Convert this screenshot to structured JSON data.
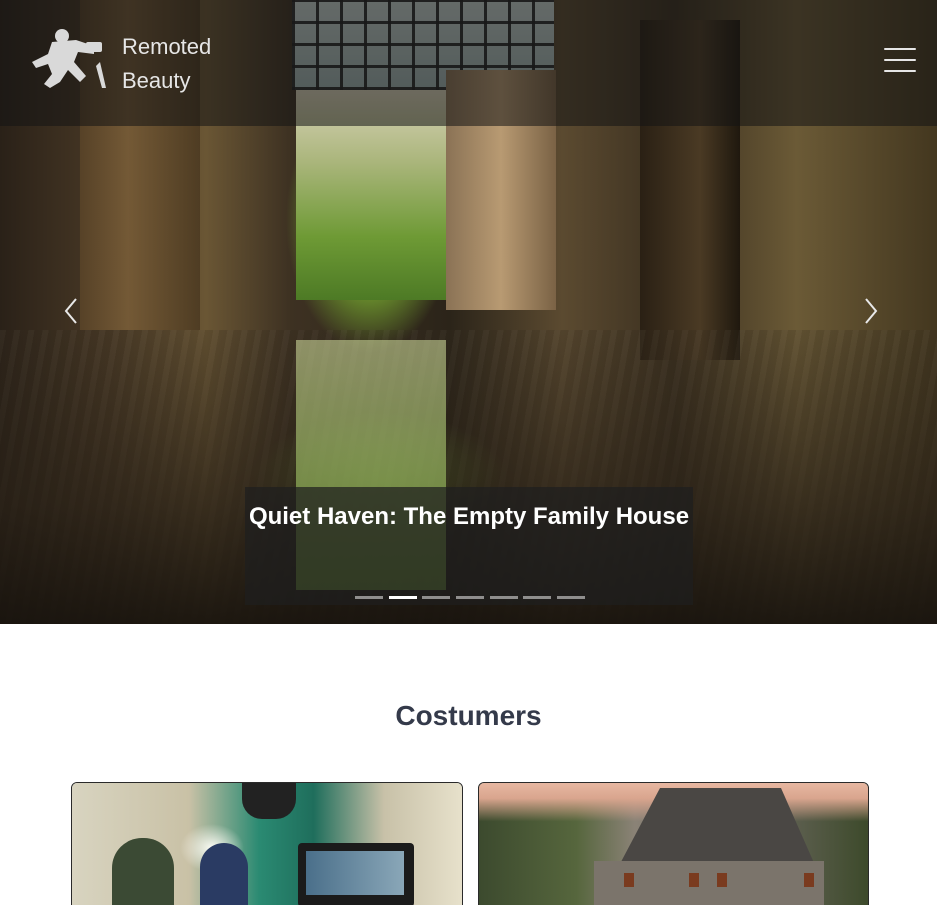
{
  "brand": {
    "line1": "Remoted",
    "line2": "Beauty",
    "logo_icon": "photographer-logo-icon"
  },
  "nav": {
    "menu_icon": "hamburger-menu-icon"
  },
  "carousel": {
    "caption": "Quiet Haven: The Empty Family House",
    "prev_icon": "chevron-left-icon",
    "next_icon": "chevron-right-icon",
    "indicator_count": 7,
    "active_index": 1
  },
  "section": {
    "title": "Costumers"
  },
  "colors": {
    "title_text": "#343a4a",
    "caption_bg": "#1e1e1e"
  }
}
